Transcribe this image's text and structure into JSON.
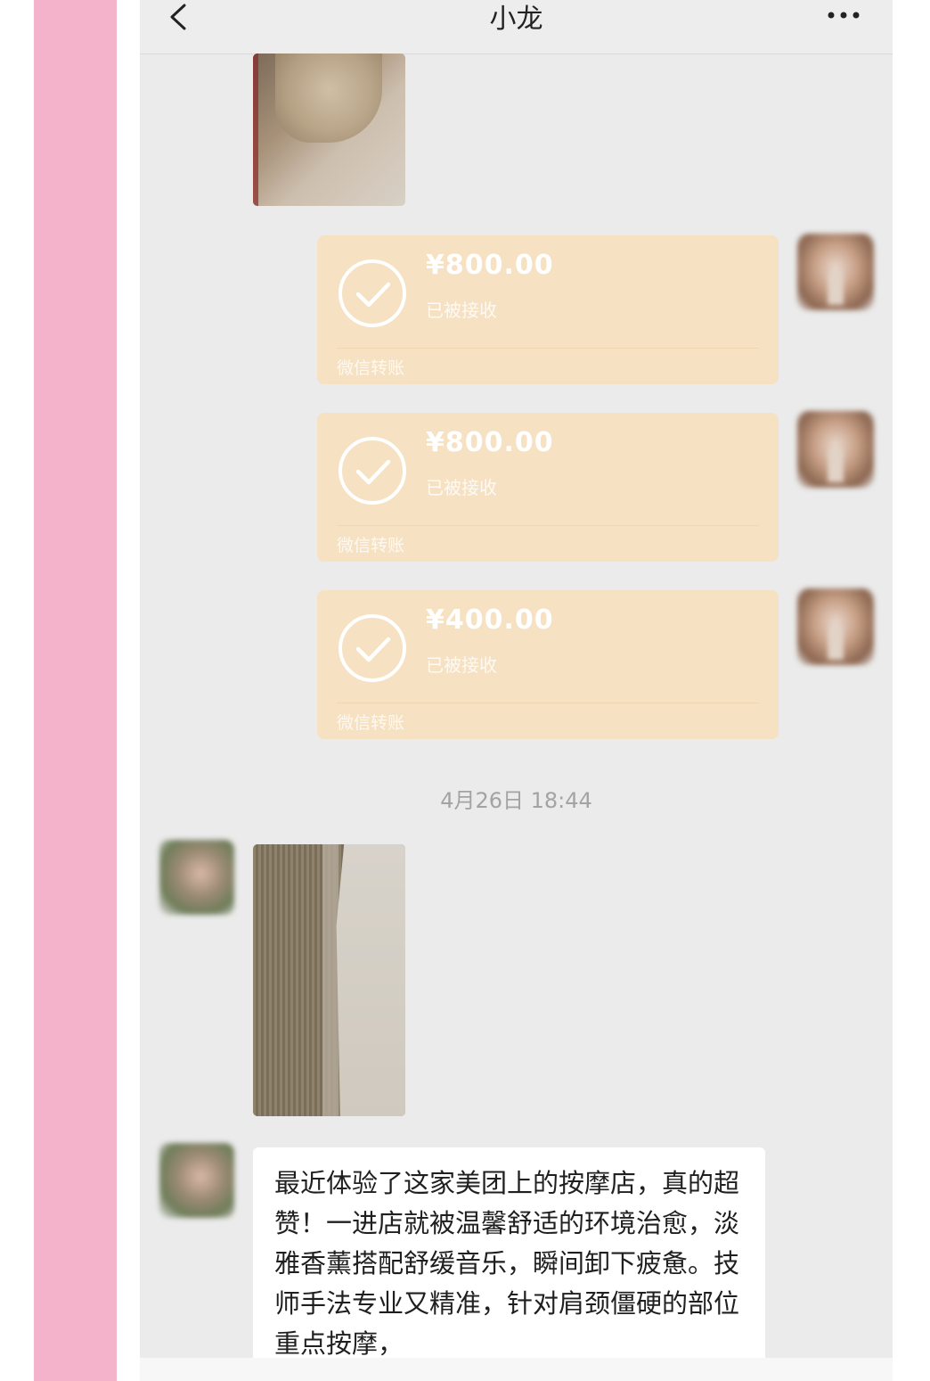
{
  "header": {
    "title": "小龙",
    "back_icon": "chevron-left-icon",
    "more_icon": "more-horizontal-icon"
  },
  "colors": {
    "page_background": "#ffffff",
    "side_strip": "#f4b2cb",
    "chat_background": "#ebebeb",
    "transfer_bubble": "#f6e1c2",
    "text_bubble": "#ffffff"
  },
  "messages": {
    "transfers": [
      {
        "amount": "¥800.00",
        "status": "已被接收",
        "footer": "微信转账",
        "icon": "check-circle-icon"
      },
      {
        "amount": "¥800.00",
        "status": "已被接收",
        "footer": "微信转账",
        "icon": "check-circle-icon"
      },
      {
        "amount": "¥400.00",
        "status": "已被接收",
        "footer": "微信转账",
        "icon": "check-circle-icon"
      }
    ],
    "timestamp": "4月26日 18:44",
    "text_message": "最近体验了这家美团上的按摩店，真的超赞！一进店就被温馨舒适的环境治愈，淡雅香薰搭配舒缓音乐，瞬间卸下疲惫。技师手法专业又精准，针对肩颈僵硬的部位重点按摩，"
  }
}
